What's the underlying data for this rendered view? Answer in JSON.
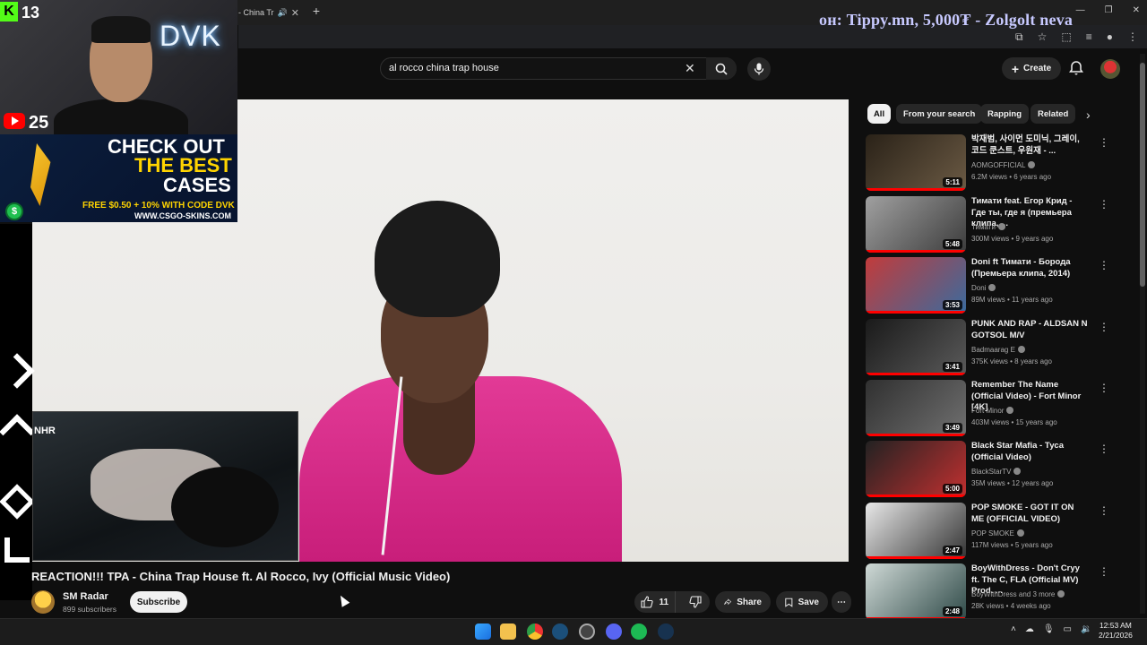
{
  "browser": {
    "tab_title": "- China Tr",
    "new_tab": "+",
    "window_controls": [
      "—",
      "❐",
      "✕"
    ],
    "ticker_text": "он: Tippy.mn, 5,000₮ - Zolgolt neva"
  },
  "youtube": {
    "search_query": "al rocco china trap house",
    "create_label": "Create",
    "video_title": "REACTION!!! TPA - China Trap House ft. Al Rocco, Ivy (Official Music Video)",
    "channel_name": "SM Radar",
    "channel_subscribers": "899 subscribers",
    "subscribe_label": "Subscribe",
    "like_count": "11",
    "share_label": "Share",
    "save_label": "Save",
    "chips": [
      "All",
      "From your search",
      "Rapping",
      "Related"
    ],
    "recommendations": [
      {
        "title": "박재범, 사이먼 도미닉, 그레이, 코드 쿤스트, 우원재 - ...",
        "channel": "AOMGOFFICIAL",
        "meta": "6.2M views • 6 years ago",
        "duration": "5:11",
        "colors": [
          "#2a2218",
          "#6b5a44"
        ]
      },
      {
        "title": "Тимати feat. Егор Крид - Где ты, где я (премьера клипа, ...",
        "channel": "Тимати",
        "meta": "300M views • 9 years ago",
        "duration": "5:48",
        "colors": [
          "#a0a0a0",
          "#3c3c3c"
        ]
      },
      {
        "title": "Doni ft Тимати - Борода (Премьера клипа, 2014)",
        "channel": "Doni",
        "meta": "89M views • 11 years ago",
        "duration": "3:53",
        "colors": [
          "#c23b3b",
          "#3a6b9e"
        ]
      },
      {
        "title": "PUNK AND RAP - ALDSAN N GOTSOL M/V",
        "channel": "Badmaarag E",
        "meta": "375K views • 8 years ago",
        "duration": "3:41",
        "colors": [
          "#1a1a1a",
          "#5a5a5a"
        ]
      },
      {
        "title": "Remember The Name (Official Video) - Fort Minor [4K]",
        "channel": "Fort Minor",
        "meta": "403M views • 15 years ago",
        "duration": "3:49",
        "colors": [
          "#303030",
          "#707070"
        ]
      },
      {
        "title": "Black Star Mafia - Туса (Official Video)",
        "channel": "BlackStarTV",
        "meta": "35M views • 12 years ago",
        "duration": "5:00",
        "colors": [
          "#222",
          "#c23030"
        ]
      },
      {
        "title": "POP SMOKE - GOT IT ON ME (OFFICIAL VIDEO)",
        "channel": "POP SMOKE",
        "meta": "117M views • 5 years ago",
        "duration": "2:47",
        "colors": [
          "#e8e8e8",
          "#333"
        ]
      },
      {
        "title": "BoyWithDress - Don't Cryy ft. The C, FLA (Official MV) Prod. ...",
        "channel": "BoyWithDress and 3 more",
        "meta": "28K views • 4 weeks ago",
        "duration": "2:48",
        "colors": [
          "#cfd9d6",
          "#2f4a48"
        ]
      }
    ]
  },
  "stream_overlay": {
    "kick_icon": "K",
    "kick_count": "13",
    "youtube_count": "25",
    "webcam_logo": "DVK",
    "ad_line1": "CHECK OUT",
    "ad_line2": "THE BEST",
    "ad_line3": "CASES",
    "ad_line4": "FREE $0.50 + 10% WITH CODE DVK",
    "ad_line5": "WWW.CSGO-SKINS.COM",
    "pip_label": "NHR"
  },
  "taskbar": {
    "time": "12:53 AM",
    "date": "2/21/2026"
  }
}
